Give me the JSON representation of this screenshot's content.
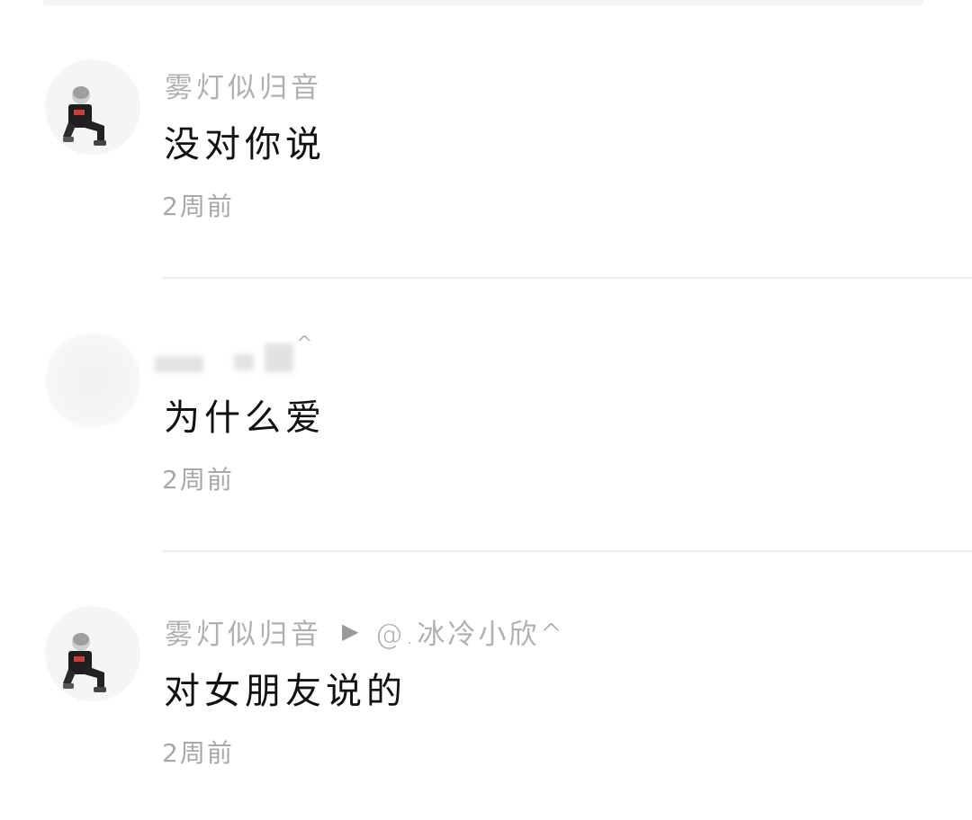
{
  "comments": [
    {
      "username": "雾灯似归音",
      "text": "没对你说",
      "time": "2周前",
      "avatar": "character-avatar"
    },
    {
      "username": "",
      "username_suffix": "^",
      "text": "为什么爱",
      "time": "2周前",
      "avatar": "blurred-avatar"
    },
    {
      "username": "雾灯似归音",
      "reply_icon": "play-arrow-icon",
      "reply_arrow": "▶",
      "reply_to": "@.冰冷小欣^",
      "text": "对女朋友说的",
      "time": "2周前",
      "avatar": "character-avatar"
    }
  ],
  "colors": {
    "username": "#b0b0b0",
    "comment_text": "#111111",
    "timestamp": "#a8a8a8",
    "divider": "#ececec",
    "reply_arrow": "#9a9a9a"
  }
}
